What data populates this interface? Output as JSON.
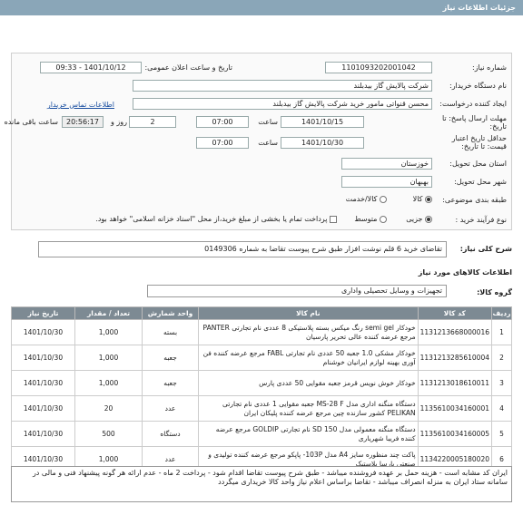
{
  "title": "جزئیات اطلاعات نیاز",
  "fields": {
    "need_number_label": "شماره نیاز:",
    "need_number": "1101093202001042",
    "announce_label": "تاریخ و ساعت اعلان عمومی:",
    "announce_value": "1401/10/12 - 09:33",
    "buyer_label": "نام دستگاه خریدار:",
    "buyer": "شرکت پالایش گاز بیدبلند",
    "creator_label": "ایجاد کننده درخواست:",
    "creator": "محسن قنواتی مامور خرید شرکت پالایش گاز بیدبلند",
    "contact_link": "اطلاعات تماس خریدار",
    "deadline_label": "مهلت ارسال پاسخ: تا تاریخ:",
    "deadline_date": "1401/10/15",
    "time_label": "ساعت",
    "deadline_time": "07:00",
    "days": "2",
    "days_label": "روز و",
    "remaining": "20:56:17",
    "remaining_label": "ساعت باقی مانده",
    "validity_label": "حداقل تاریخ اعتبار قیمت: تا تاریخ:",
    "validity_date": "1401/10/30",
    "validity_time": "07:00",
    "province_label": "استان محل تحویل:",
    "province": "خوزستان",
    "city_label": "شهر محل تحویل:",
    "city": "بهبهان",
    "category_label": "طبقه بندی موضوعی:",
    "cat_goods": "کالا",
    "cat_goods_service": "کالا/خدمت",
    "process_label": "نوع فرآیند خرید :",
    "proc_partial": "جزیی",
    "proc_medium": "متوسط",
    "payment_note": "پرداخت تمام یا بخشی از مبلغ خرید،از محل \"اسناد خزانه اسلامی\" خواهد بود."
  },
  "summary": {
    "label": "شرح کلی نیاز:",
    "text": "تقاضای خرید 6 قلم نوشت افزار طبق شرح پیوست تقاضا به شماره 0149306"
  },
  "goods_info_title": "اطلاعات کالاهای مورد نیاز",
  "group": {
    "label": "گروه کالا:",
    "value": "تجهیزات و وسایل تحصیلی واداری"
  },
  "table": {
    "headers": [
      "ردیف",
      "کد کالا",
      "نام کالا",
      "واحد شمارش",
      "تعداد / مقدار",
      "تاریخ نیاز"
    ],
    "rows": [
      [
        "1",
        "1131213668000016",
        "خودکار semi gel رنگ میکس بسته پلاستیکی 8 عددی نام تجارتی PANTER مرجع عرضه کننده عالی تحریر پارسیان",
        "بسته",
        "1,000",
        "1401/10/30"
      ],
      [
        "2",
        "1131213285610004",
        "خودکار مشکی 1.0 جعبه 50 عددی نام تجارتی FABL مرجع عرضه کننده فن آوری بهینه لوازم ایرانیان خوشنام",
        "جعبه",
        "1,000",
        "1401/10/30"
      ],
      [
        "3",
        "1131213018610011",
        "خودکار خوش نویس قرمز جعبه مقوایی 50 عددی پارس",
        "جعبه",
        "1,000",
        "1401/10/30"
      ],
      [
        "4",
        "1135610034160001",
        "دستگاه منگنه اداری مدل MS-28 F جعبه مقوایی 1 عددی نام تجارتی PELIKAN کشور سازنده چین مرجع عرضه کننده پلیکان ایران",
        "عدد",
        "20",
        "1401/10/30"
      ],
      [
        "5",
        "1135610034160005",
        "دستگاه منگنه معمولی مدل SD 150 نام تجارتی GOLDIP مرجع عرضه کننده فریبا شهریاری",
        "دستگاه",
        "500",
        "1401/10/30"
      ],
      [
        "6",
        "1134220005180020",
        "پاکت چند منظوره سایز A4 مدل 103P- پاپکو مرجع عرضه کننده تولیدی و صنعتی پارسا پلاستیک",
        "عدد",
        "1,000",
        "1401/10/30"
      ]
    ]
  },
  "notes": "ایران کد مشابه است - هزینه حمل بر عهده فروشنده میباشد - طبق شرح پیوست تقاضا اقدام شود - پرداخت 2 ماه - عدم ارائه هر گونه پیشنهاد فنی و مالی در سامانه ستاد ایران به منزله انصراف میباشد - تقاضا براساس اعلام نیاز واحد کالا خریداری میگردد"
}
